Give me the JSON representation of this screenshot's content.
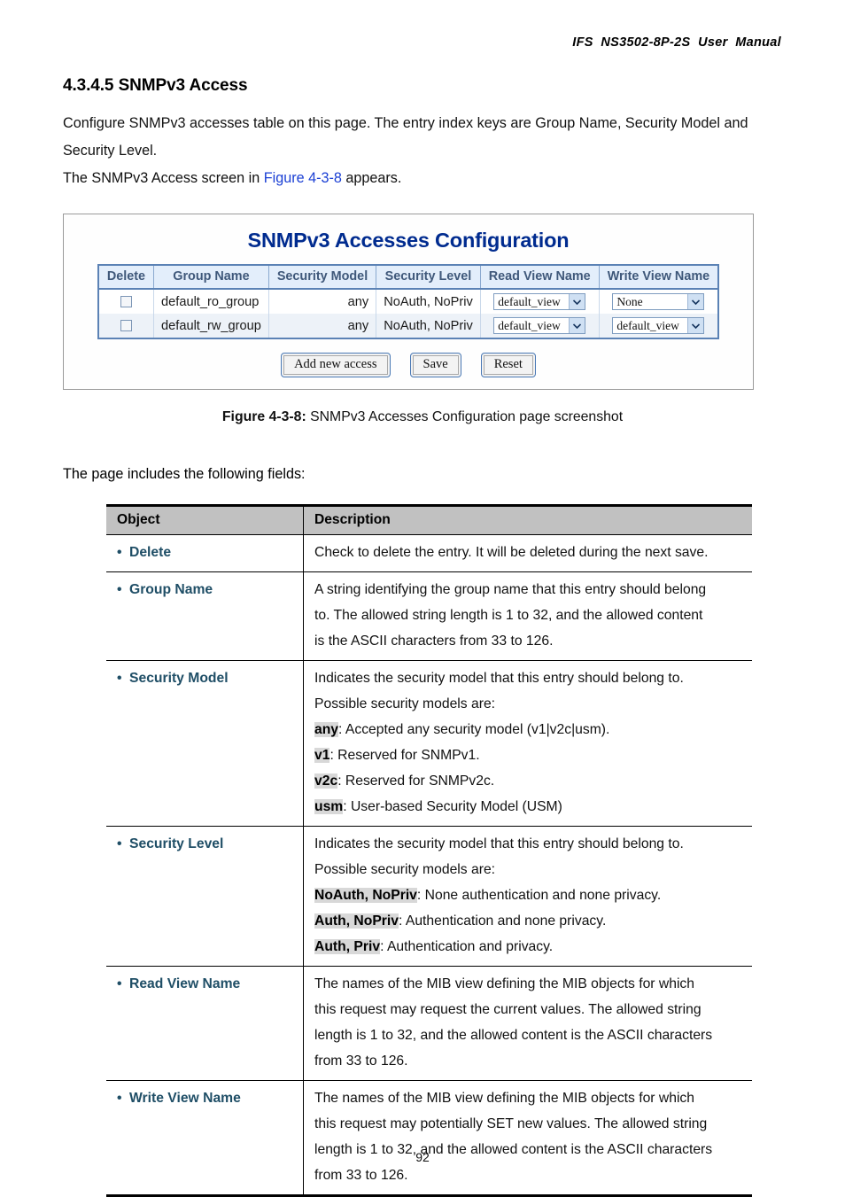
{
  "header": {
    "running_title": "IFS  NS3502-8P-2S  User  Manual"
  },
  "section": {
    "title": "4.3.4.5 SNMPv3 Access",
    "paragraph_1": "Configure SNMPv3 accesses table on this page. The entry index keys are Group Name, Security Model and Security Level.",
    "paragraph_2_before": "The SNMPv3 Access screen in ",
    "paragraph_2_link": "Figure 4-3-8",
    "paragraph_2_after": " appears."
  },
  "figure": {
    "ui_title": "SNMPv3 Accesses Configuration",
    "table": {
      "headers": [
        "Delete",
        "Group Name",
        "Security Model",
        "Security Level",
        "Read View Name",
        "Write View Name"
      ],
      "rows": [
        {
          "delete_checked": false,
          "group_name": "default_ro_group",
          "security_model": "any",
          "security_level": "NoAuth, NoPriv",
          "read_view_name": "default_view",
          "write_view_name": "None"
        },
        {
          "delete_checked": false,
          "group_name": "default_rw_group",
          "security_model": "any",
          "security_level": "NoAuth, NoPriv",
          "read_view_name": "default_view",
          "write_view_name": "default_view"
        }
      ]
    },
    "buttons": {
      "add_new_access": "Add new access",
      "save": "Save",
      "reset": "Reset"
    },
    "caption_label": "Figure 4-3-8:",
    "caption_text": " SNMPv3 Accesses Configuration page screenshot"
  },
  "fields_intro": "The page includes the following fields:",
  "desc_table": {
    "headers": {
      "object": "Object",
      "description": "Description"
    },
    "rows": [
      {
        "object": "Delete",
        "lines": [
          {
            "text": "Check to delete the entry. It will be deleted during the next save."
          }
        ]
      },
      {
        "object": "Group Name",
        "lines": [
          {
            "text": "A string identifying the group name that this entry should belong"
          },
          {
            "text": "to. The allowed string length is 1 to 32, and the allowed content"
          },
          {
            "text": "is the ASCII characters from 33 to 126."
          }
        ]
      },
      {
        "object": "Security Model",
        "lines": [
          {
            "text": "Indicates the security model that this entry should belong to."
          },
          {
            "text": "Possible security models are:"
          },
          {
            "keyword": "any",
            "text": ": Accepted any security model (v1|v2c|usm)."
          },
          {
            "keyword": "v1",
            "text": ": Reserved for SNMPv1."
          },
          {
            "keyword": "v2c",
            "text": ": Reserved for SNMPv2c."
          },
          {
            "keyword": "usm",
            "text": ": User-based Security Model (USM)"
          }
        ]
      },
      {
        "object": "Security Level",
        "lines": [
          {
            "text": "Indicates the security model that this entry should belong to."
          },
          {
            "text": "Possible security models are:"
          },
          {
            "keyword": "NoAuth, NoPriv",
            "text": ": None authentication and none privacy."
          },
          {
            "keyword": "Auth, NoPriv",
            "text": ": Authentication and none privacy."
          },
          {
            "keyword": "Auth, Priv",
            "text": ": Authentication and privacy."
          }
        ]
      },
      {
        "object": "Read View Name",
        "lines": [
          {
            "text": "The names of the MIB view defining the MIB objects for which"
          },
          {
            "text": "this request may request the current values. The allowed string"
          },
          {
            "text": "length is 1 to 32, and the allowed content is the ASCII characters"
          },
          {
            "text": "from 33 to 126."
          }
        ]
      },
      {
        "object": "Write View Name",
        "lines": [
          {
            "text": "The names of the MIB view defining the MIB objects for which"
          },
          {
            "text": "this request may potentially SET new values. The allowed string"
          },
          {
            "text": "length is 1 to 32, and the allowed content is the ASCII characters"
          },
          {
            "text": "from 33 to 126."
          }
        ]
      }
    ]
  },
  "footer": {
    "page_number": "92"
  }
}
